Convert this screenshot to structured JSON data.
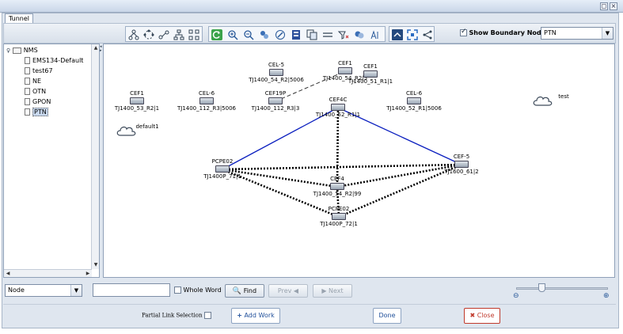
{
  "window": {
    "tab_label": "Tunnel"
  },
  "toolbar": {
    "show_boundary_label": "Show Boundary Nodes",
    "show_boundary_checked": true,
    "domain_select_value": "PTN",
    "group1_icons": [
      "layout-tree-icon",
      "layout-circle-icon",
      "layout-spring-icon",
      "layout-hierarchy-icon",
      "layout-grid-icon"
    ],
    "group2_icons": [
      "refresh-icon",
      "zoom-in-icon",
      "zoom-out-icon",
      "fit-icon",
      "pan-icon",
      "save-icon",
      "copy-icon",
      "line-icon",
      "filter-icon",
      "layers-icon",
      "text-icon"
    ],
    "group3_icons": [
      "collapse-icon",
      "fullscreen-icon",
      "share-icon"
    ]
  },
  "tree": {
    "root": "NMS",
    "children": [
      "EMS134-Default",
      "test67",
      "NE",
      "OTN",
      "GPON",
      "PTN"
    ],
    "selected": "PTN"
  },
  "topology": {
    "nodes": [
      {
        "id": "cel5",
        "label": "CEL-5",
        "sub": "TJ1400_54_R2|5006",
        "kind": "device"
      },
      {
        "id": "cef1a",
        "label": "CEF1",
        "sub": "TJ1400_54_R2|5",
        "kind": "device"
      },
      {
        "id": "cef1b",
        "label": "CEF1",
        "sub": "TJ1400_51_R1|1",
        "kind": "device"
      },
      {
        "id": "cef1c",
        "label": "CEF1",
        "sub": "TJ1400_53_R2|1",
        "kind": "device"
      },
      {
        "id": "cel6a",
        "label": "CEL-6",
        "sub": "TJ1400_112_R3|5006",
        "kind": "device"
      },
      {
        "id": "cef19p",
        "label": "CEF19P",
        "sub": "TJ1400_112_R3|3",
        "kind": "device"
      },
      {
        "id": "cef4c",
        "label": "CEF4C",
        "sub": "TJ1400_52_R1|1",
        "kind": "device"
      },
      {
        "id": "cel6b",
        "label": "CEL-6",
        "sub": "TJ1400_52_R1|5006",
        "kind": "device"
      },
      {
        "id": "test",
        "label": "test",
        "sub": "",
        "kind": "cloud"
      },
      {
        "id": "default1",
        "label": "default1",
        "sub": "",
        "kind": "cloud"
      },
      {
        "id": "pcpe02a",
        "label": "PCPE02",
        "sub": "TJ1400P_71|1",
        "kind": "device"
      },
      {
        "id": "cef5",
        "label": "CEF-5",
        "sub": "TJ1600_61|2",
        "kind": "device"
      },
      {
        "id": "cef4",
        "label": "CEF4",
        "sub": "TJ1400_54_R2|99",
        "kind": "device"
      },
      {
        "id": "pcpe02b",
        "label": "PCPE02",
        "sub": "TJ1400P_72|1",
        "kind": "device"
      }
    ],
    "links": [
      {
        "from": "pcpe02a",
        "to": "cef4c",
        "style": "solid"
      },
      {
        "from": "cef4c",
        "to": "cef5",
        "style": "solid"
      },
      {
        "from": "cef19p",
        "to": "cef1a",
        "style": "dashed"
      },
      {
        "from": "cef4c",
        "to": "cef4",
        "style": "dotted"
      },
      {
        "from": "pcpe02a",
        "to": "cef5",
        "style": "dotted"
      },
      {
        "from": "pcpe02a",
        "to": "cef4",
        "style": "dotted"
      },
      {
        "from": "pcpe02a",
        "to": "pcpe02b",
        "style": "dotted"
      },
      {
        "from": "cef5",
        "to": "cef4",
        "style": "dotted"
      },
      {
        "from": "cef5",
        "to": "pcpe02b",
        "style": "dotted"
      },
      {
        "from": "cef4",
        "to": "pcpe02b",
        "style": "dotted"
      }
    ]
  },
  "find": {
    "type_value": "Node",
    "query": "",
    "whole_word_label": "Whole Word",
    "find_label": "Find",
    "prev_label": "Prev",
    "next_label": "Next"
  },
  "bottom": {
    "partial_link_label": "Partial Link Selection",
    "add_work_label": "Add Work",
    "done_label": "Done",
    "close_label": "Close"
  },
  "colors": {
    "accent_blue": "#0b1fbf",
    "close_red": "#c0392b"
  }
}
